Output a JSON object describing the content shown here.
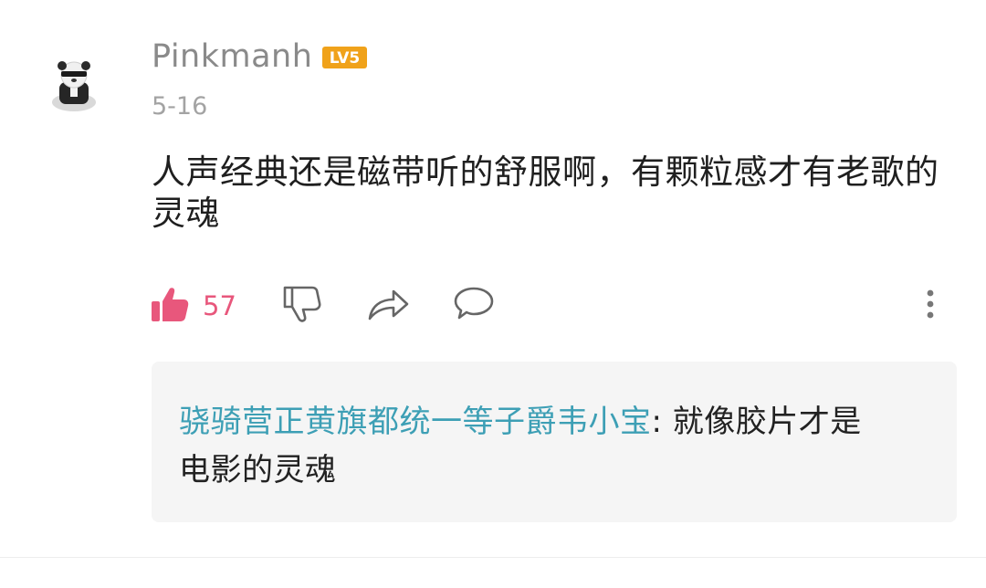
{
  "comment": {
    "username": "Pinkmanh",
    "level": "LV5",
    "date": "5-16",
    "content": "人声经典还是磁带听的舒服啊，有颗粒感才有老歌的灵魂",
    "like_count": "57"
  },
  "reply": {
    "author": "骁骑营正黄旗都统一等子爵韦小宝",
    "separator": ": ",
    "text": "就像胶片才是电影的灵魂"
  },
  "colors": {
    "like_accent": "#e8577c",
    "reply_author": "#3d9fb5",
    "level_badge": "#f0a21a"
  },
  "icons": {
    "like": "thumbs-up-icon",
    "dislike": "thumbs-down-icon",
    "share": "share-icon",
    "reply": "comment-icon",
    "more": "more-vertical-icon"
  }
}
